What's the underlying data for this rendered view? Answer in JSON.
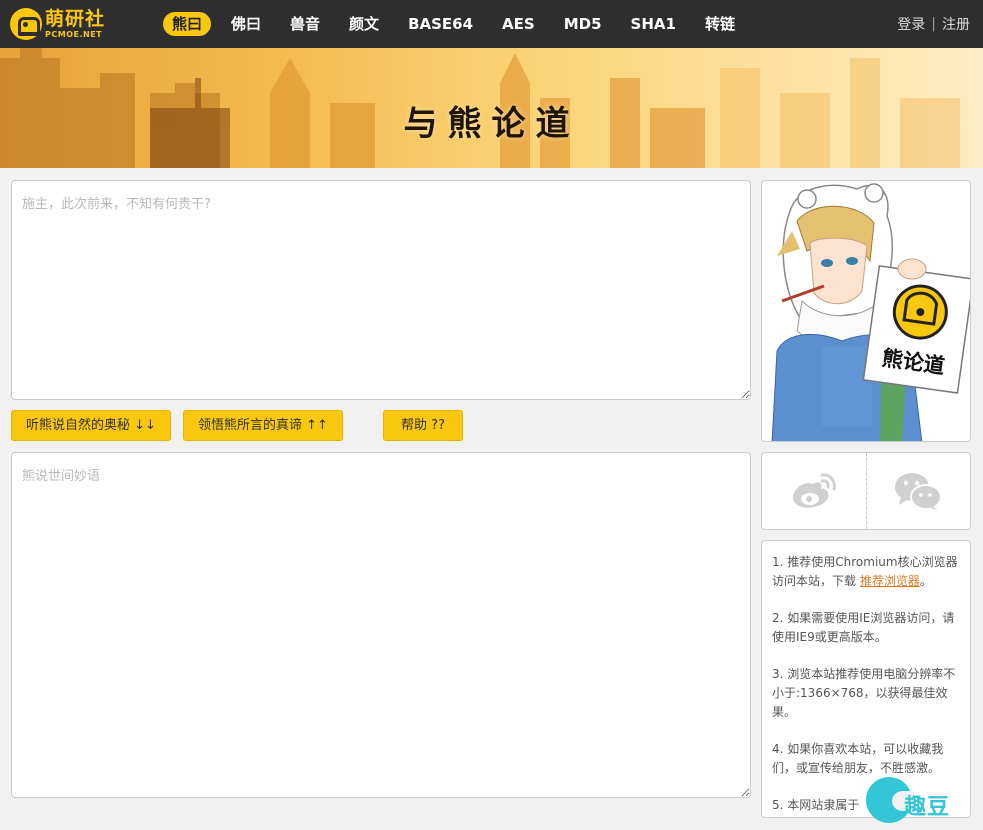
{
  "brand": {
    "name": "萌研社",
    "domain": "PCMOE.NET",
    "accent": "#f9c70d"
  },
  "nav": {
    "items": [
      {
        "label": "熊曰",
        "active": true
      },
      {
        "label": "佛曰",
        "active": false
      },
      {
        "label": "兽音",
        "active": false
      },
      {
        "label": "颜文",
        "active": false
      },
      {
        "label": "BASE64",
        "active": false
      },
      {
        "label": "AES",
        "active": false
      },
      {
        "label": "MD5",
        "active": false
      },
      {
        "label": "SHA1",
        "active": false
      },
      {
        "label": "转链",
        "active": false
      }
    ],
    "login": "登录",
    "separator": "|",
    "register": "注册"
  },
  "banner": {
    "title": "与熊论道"
  },
  "editor": {
    "input_placeholder": "施主，此次前来，不知有何贵干?",
    "output_placeholder": "熊说世间妙语",
    "encode_label": "听熊说自然的奥秘 ↓↓",
    "decode_label": "领悟熊所言的真谛 ↑↑",
    "help_label": "帮助 ??"
  },
  "mascot": {
    "sign_text": "熊论道"
  },
  "share": {
    "weibo_icon": "weibo-icon",
    "wechat_icon": "wechat-icon"
  },
  "notes": [
    {
      "prefix": "1. 推荐使用Chromium核心浏览器访问本站，下载 ",
      "link": "推荐浏览器",
      "suffix": "。"
    },
    {
      "text": "2. 如果需要使用IE浏览器访问，请使用IE9或更高版本。"
    },
    {
      "text": "3. 浏览本站推荐使用电脑分辨率不小于:1366×768，以获得最佳效果。"
    },
    {
      "text": "4. 如果你喜欢本站，可以收藏我们，或宣传给朋友，不胜感激。"
    },
    {
      "text": "5. 本网站隶属于"
    }
  ],
  "watermark": {
    "text": "趣豆"
  }
}
